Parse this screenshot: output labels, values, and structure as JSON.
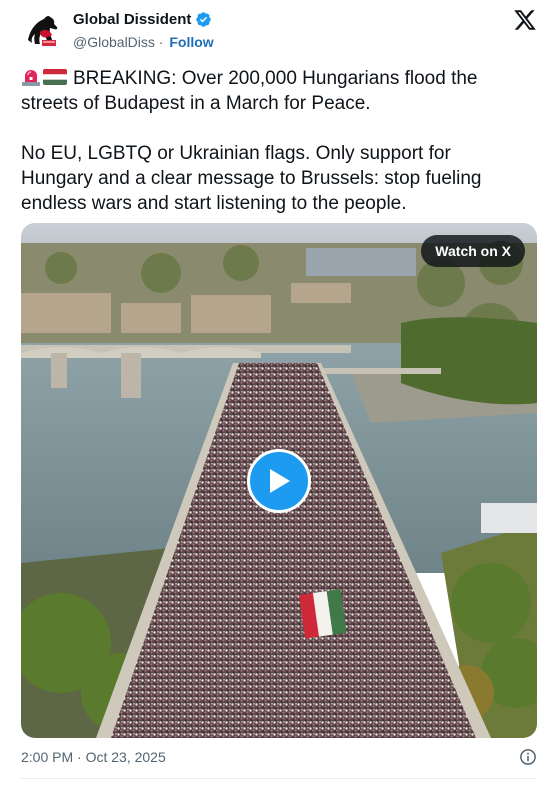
{
  "author": {
    "display_name": "Global Dissident",
    "handle": "@GlobalDiss",
    "separator": "·",
    "follow_label": "Follow",
    "verified": true,
    "avatar_icon": "horse-avatar-icon"
  },
  "tweet": {
    "paragraph1": "BREAKING: Over 200,000 Hungarians flood the streets of Budapest in a March for Peace.",
    "paragraph2": "No EU, LGBTQ or Ukrainian flags. Only support for Hungary and a clear message to Brussels: stop fueling endless wars and start listening to the people.",
    "emoji": [
      "siren-icon",
      "hungary-flag-icon"
    ]
  },
  "media": {
    "watch_label": "Watch on X",
    "play_icon": "play-icon"
  },
  "footer": {
    "time": "2:00 PM",
    "separator": "·",
    "date": "Oct 23, 2025",
    "info_icon": "info-icon"
  },
  "colors": {
    "accent": "#1d9bf0",
    "follow": "#1d6fb8",
    "text": "#0f1419",
    "muted": "#536471"
  }
}
